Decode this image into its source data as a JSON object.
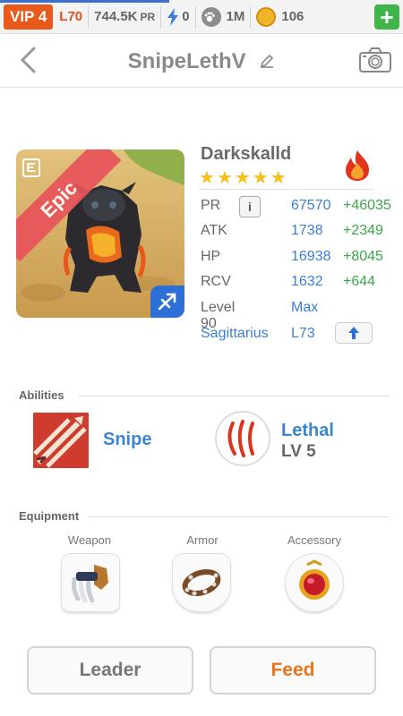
{
  "status_bar": {
    "vip": "VIP 4",
    "level": "L70",
    "pr_value": "744.5K",
    "pr_unit": "PR",
    "energy": "0",
    "food": "1M",
    "coins": "106",
    "add_label": "+",
    "progress_percent": 42
  },
  "header": {
    "title": "SnipeLethV"
  },
  "monster": {
    "rarity": "Epic",
    "name": "Darkskalld",
    "stars": 5,
    "element": "fire",
    "stats": [
      {
        "label": "PR",
        "value": "67570",
        "bonus": "+46035"
      },
      {
        "label": "ATK",
        "value": "1738",
        "bonus": "+2349"
      },
      {
        "label": "HP",
        "value": "16938",
        "bonus": "+8045"
      },
      {
        "label": "RCV",
        "value": "1632",
        "bonus": "+644"
      }
    ],
    "level_label": "Level 90",
    "level_value": "Max",
    "sign_label": "Sagittarius",
    "sign_value": "L73",
    "info_label": "i"
  },
  "abilities": {
    "title": "Abilities",
    "items": [
      {
        "name": "Snipe",
        "level": ""
      },
      {
        "name": "Lethal",
        "level": "LV 5"
      }
    ]
  },
  "equipment": {
    "title": "Equipment",
    "slots": [
      "Weapon",
      "Armor",
      "Accessory"
    ]
  },
  "buttons": {
    "leader": "Leader",
    "feed": "Feed"
  },
  "colors": {
    "vip": "#e85a1c",
    "accent_blue": "#3a7fd0",
    "bonus_green": "#3aa84a",
    "feed_orange": "#e8751f",
    "epic_red": "#e8535b"
  }
}
